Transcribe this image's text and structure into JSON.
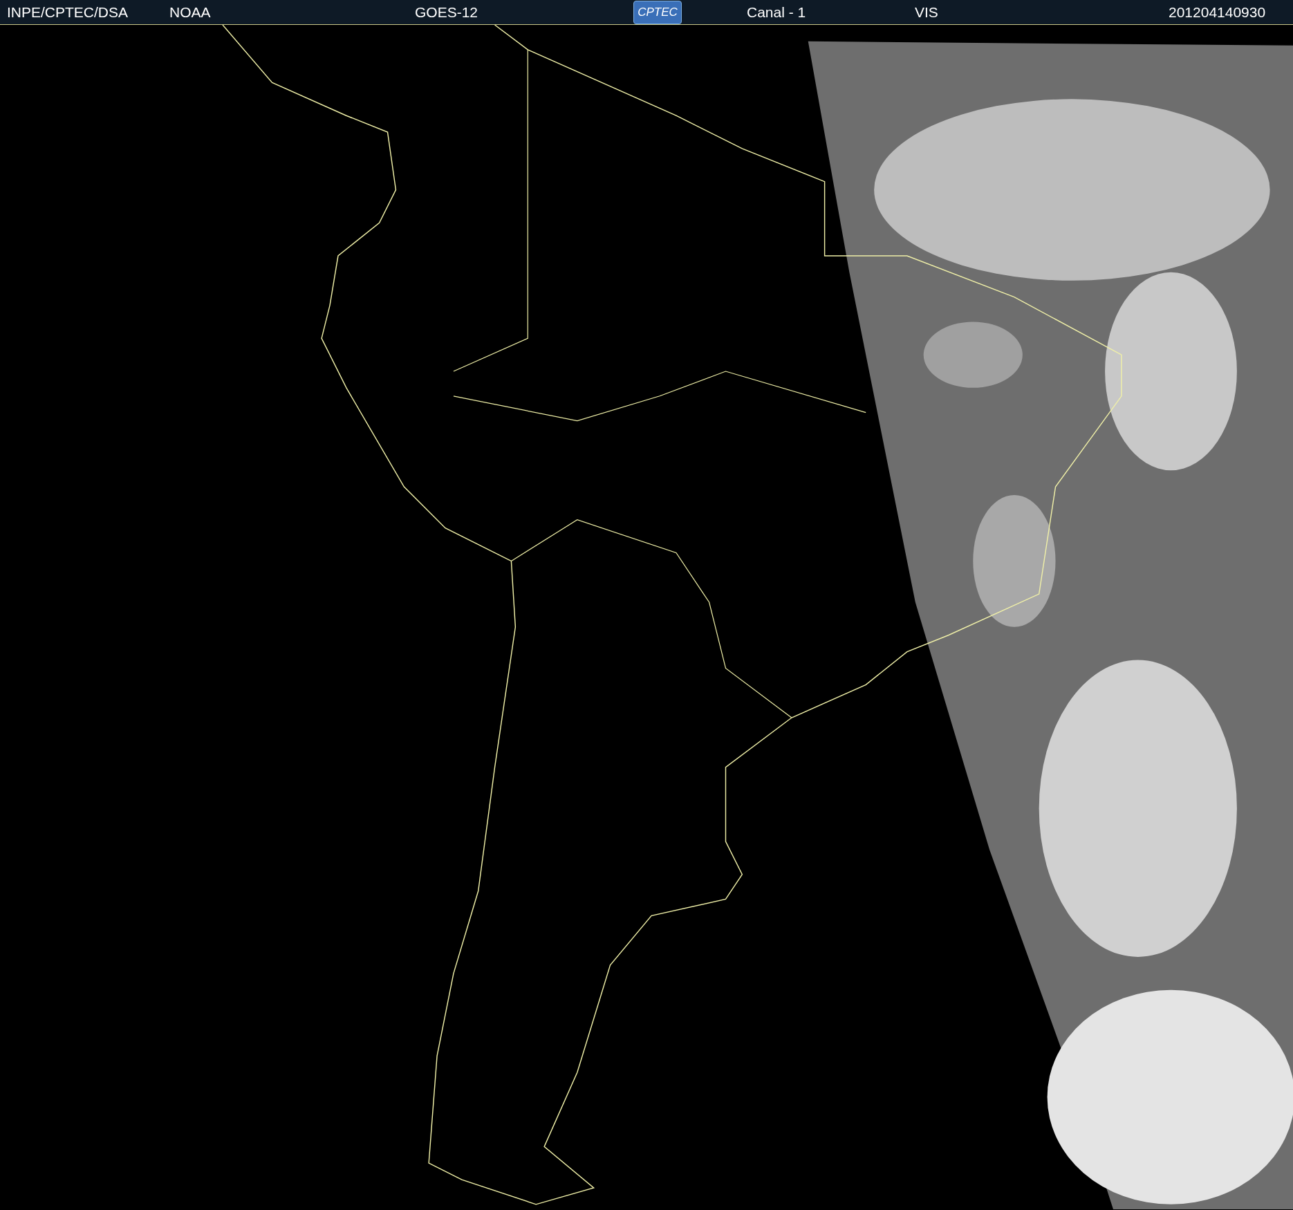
{
  "header": [
    {
      "kind": "text",
      "text": "INPE/CPTEC/DSA"
    },
    {
      "kind": "text",
      "text": "NOAA"
    },
    {
      "kind": "text",
      "text": "GOES-12"
    },
    {
      "kind": "logo",
      "text": "CPTEC"
    },
    {
      "kind": "text",
      "text": "Canal - 1"
    },
    {
      "kind": "text",
      "text": "VIS"
    },
    {
      "kind": "text",
      "text": "201204140930"
    }
  ]
}
